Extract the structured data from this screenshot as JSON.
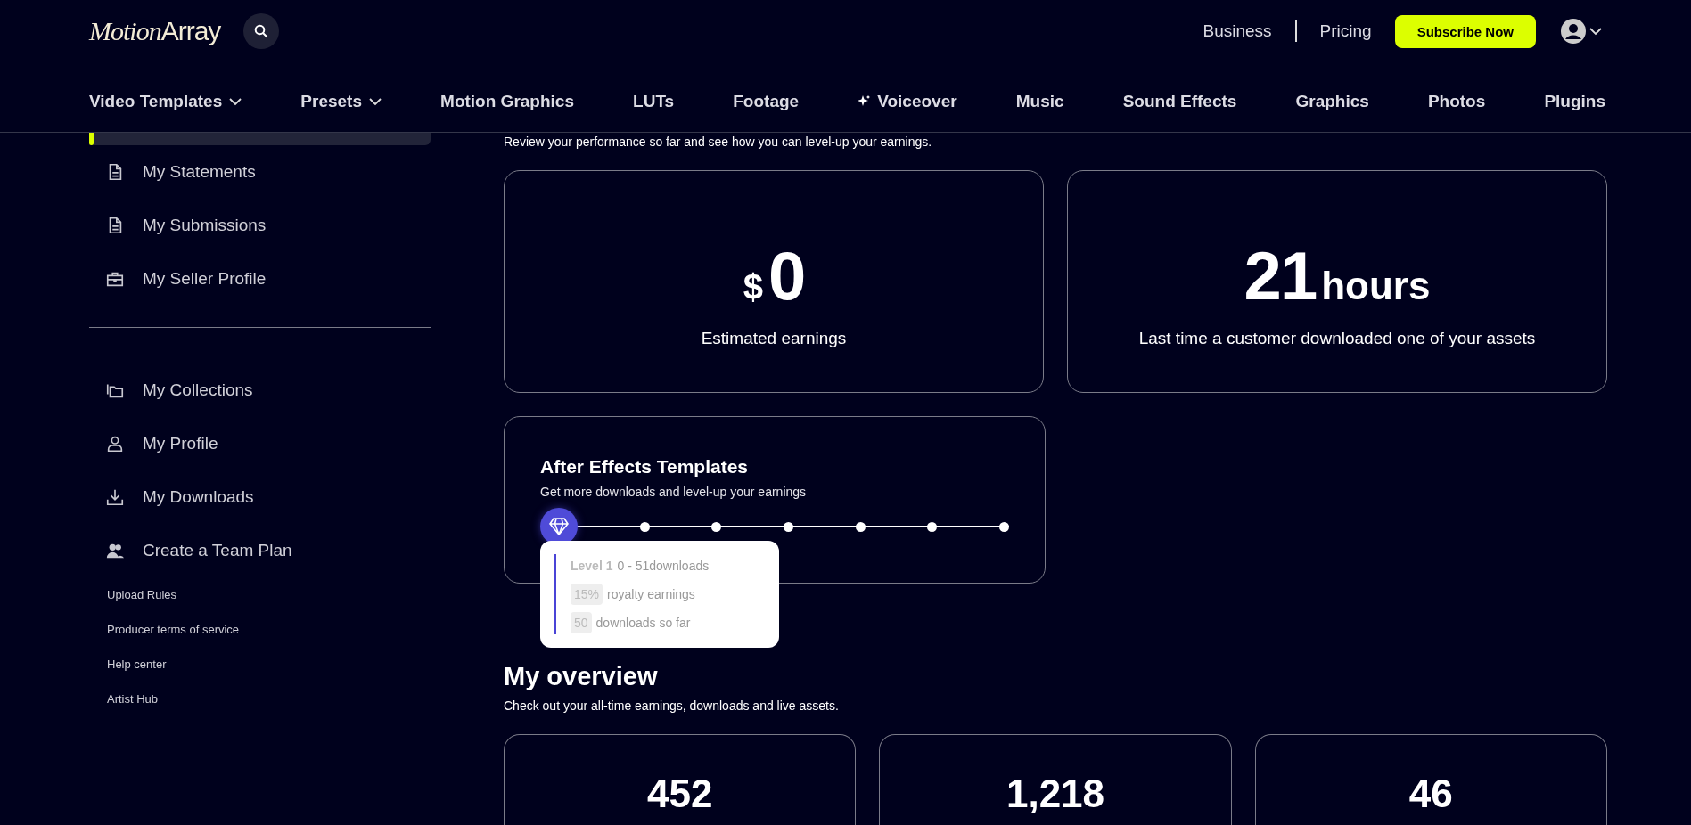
{
  "header": {
    "logo": {
      "part_1": "Motion",
      "part_2": "Array"
    },
    "links": [
      "Business",
      "Pricing"
    ],
    "subscribe_button": "Subscribe Now"
  },
  "nav": [
    {
      "label": "Video Templates",
      "dropdown": true,
      "sparkle": false
    },
    {
      "label": "Presets",
      "dropdown": true,
      "sparkle": false
    },
    {
      "label": "Motion Graphics",
      "dropdown": false,
      "sparkle": false
    },
    {
      "label": "LUTs",
      "dropdown": false,
      "sparkle": false
    },
    {
      "label": "Footage",
      "dropdown": false,
      "sparkle": false
    },
    {
      "label": "Voiceover",
      "dropdown": false,
      "sparkle": true
    },
    {
      "label": "Music",
      "dropdown": false,
      "sparkle": false
    },
    {
      "label": "Sound Effects",
      "dropdown": false,
      "sparkle": false
    },
    {
      "label": "Graphics",
      "dropdown": false,
      "sparkle": false
    },
    {
      "label": "Photos",
      "dropdown": false,
      "sparkle": false
    },
    {
      "label": "Plugins",
      "dropdown": false,
      "sparkle": false
    }
  ],
  "sidebar": {
    "items": [
      "My Statements",
      "My Submissions",
      "My Seller Profile"
    ],
    "items_2": [
      "My Collections",
      "My Profile",
      "My Downloads",
      "Create a Team Plan"
    ],
    "links": [
      "Upload Rules",
      "Producer terms of service",
      "Help center",
      "Artist Hub"
    ]
  },
  "performance": {
    "subtitle": "Review your performance so far and see how you can level-up your earnings.",
    "cards": [
      {
        "prefix": "$",
        "value": "0",
        "label": "Estimated earnings"
      },
      {
        "value": "21",
        "suffix": "hours",
        "label": "Last time a customer downloaded one of your assets"
      }
    ]
  },
  "level_card": {
    "title": "After Effects Templates",
    "subtitle": "Get more downloads and level-up your earnings",
    "steps": [
      {
        "selected": true
      },
      {
        "selected": false
      },
      {
        "selected": false
      },
      {
        "selected": false
      },
      {
        "selected": false
      },
      {
        "selected": false
      },
      {
        "selected": false
      }
    ],
    "tooltip": {
      "level": "Level 1",
      "range": "0 - 51downloads",
      "royalty_value": "15%",
      "royalty_label": "royalty earnings",
      "downloads_value": "50",
      "downloads_label": "downloads so far"
    }
  },
  "overview": {
    "title": "My overview",
    "subtitle": "Check out your all-time earnings, downloads and live assets.",
    "cards": [
      "452",
      "1,218",
      "46"
    ]
  }
}
